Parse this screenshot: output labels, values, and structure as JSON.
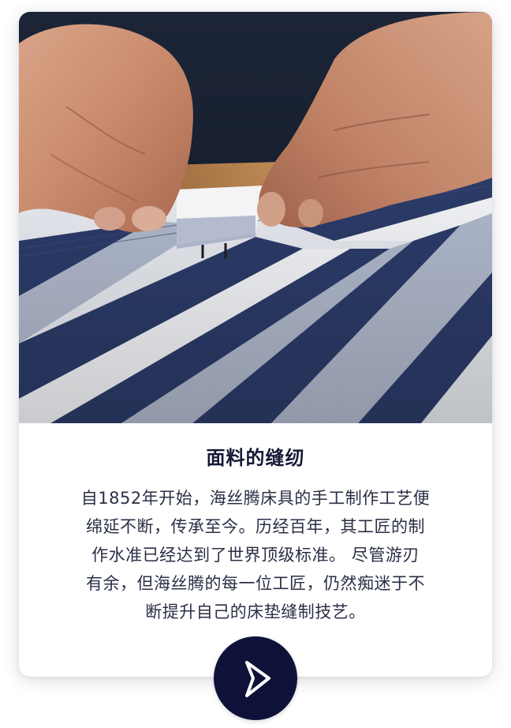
{
  "card": {
    "image_alt": "hands stitching blue and white striped fabric",
    "title": "面料的缝纫",
    "body_lines": [
      "自1852年开始，海丝腾床具的手工制作工艺便",
      "绵延不断，传承至今。历经百年，其工匠的制",
      "作水准已经达到了世界顶级标准。 尽管游刃",
      "有余，但海丝腾的每一位工匠，仍然痴迷于不",
      "断提升自己的床垫缝制技艺。"
    ]
  },
  "play_button": {
    "icon": "play-icon"
  },
  "colors": {
    "navy": "#0f1238",
    "stripe_blue": "#2c3c6a",
    "title_text": "#141a36",
    "body_text": "#2a2f45"
  }
}
